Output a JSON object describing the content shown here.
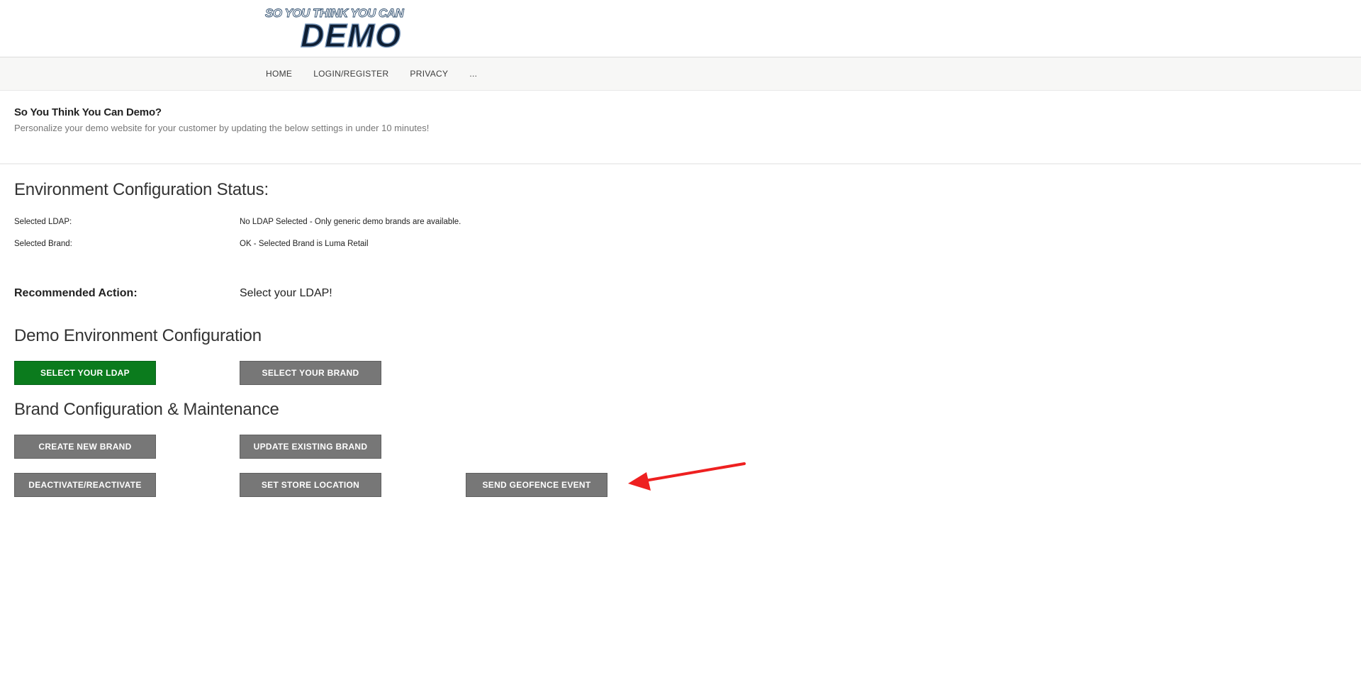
{
  "logo": {
    "tagline": "SO YOU THINK YOU CAN",
    "word": "DEMO",
    "icon": "site-logo"
  },
  "nav": {
    "items": [
      {
        "label": "HOME"
      },
      {
        "label": "LOGIN/REGISTER"
      },
      {
        "label": "PRIVACY"
      },
      {
        "label": "..."
      }
    ]
  },
  "intro": {
    "title": "So You Think You Can Demo?",
    "subtitle": "Personalize your demo website for your customer by updating the below settings in under 10 minutes!"
  },
  "status": {
    "heading": "Environment Configuration Status:",
    "rows": [
      {
        "label": "Selected LDAP:",
        "value": "No LDAP Selected - Only generic demo brands are available."
      },
      {
        "label": "Selected Brand:",
        "value": "OK - Selected Brand is Luma Retail"
      }
    ]
  },
  "recommended": {
    "label": "Recommended Action:",
    "value": "Select your LDAP!"
  },
  "env_config": {
    "heading": "Demo Environment Configuration",
    "buttons": [
      {
        "label": "SELECT YOUR LDAP"
      },
      {
        "label": "SELECT YOUR BRAND"
      }
    ]
  },
  "brand_config": {
    "heading": "Brand Configuration & Maintenance",
    "buttons": [
      {
        "label": "CREATE NEW BRAND"
      },
      {
        "label": "UPDATE EXISTING BRAND"
      },
      {
        "label": "DEACTIVATE/REACTIVATE"
      },
      {
        "label": "SET STORE LOCATION"
      },
      {
        "label": "SEND GEOFENCE EVENT"
      }
    ]
  },
  "colors": {
    "primary_button": "#0b7b1d",
    "secondary_button": "#777777",
    "annotation_arrow": "#ee2020"
  },
  "annotation": {
    "icon": "red-arrow-icon"
  }
}
